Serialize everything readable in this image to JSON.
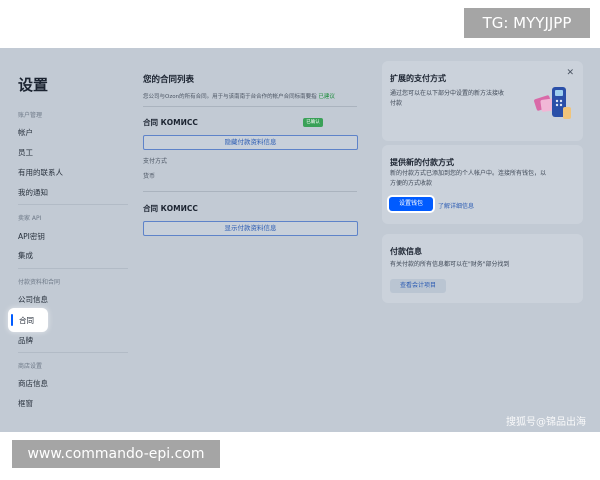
{
  "overlay": {
    "tg_label": "TG: MYYJJPP",
    "url_label": "www.commando-epi.com"
  },
  "watermark": "搜狐号@锦品出海",
  "sidebar": {
    "title": "设置",
    "groups": [
      {
        "label": "账户管理",
        "items": [
          "帐户",
          "员工",
          "有用的联系人",
          "我的通知"
        ]
      },
      {
        "label": "卖家 API",
        "items": [
          "API密钥",
          "集成"
        ]
      },
      {
        "label": "付款资料和合同",
        "items": [
          "公司信息",
          "合同",
          "品牌"
        ]
      },
      {
        "label": "商店设置",
        "items": [
          "商店信息",
          "框窗"
        ]
      }
    ],
    "active_item": "合同"
  },
  "contracts": {
    "title": "您的合同列表",
    "description": "您公司与Ozon的所有合同。用于与该南南于台合作的帐户合同标南要指",
    "description_link": "已建议",
    "items": [
      {
        "name": "合同 КОМИСС",
        "badge": "已确认",
        "toggle_label": "隐藏付款资料信息",
        "fields": [
          {
            "label": "支付方式"
          },
          {
            "label": "货币"
          }
        ]
      },
      {
        "name": "合同 КОМИСС",
        "toggle_label": "显示付款资料信息"
      }
    ]
  },
  "cards": {
    "extended_payment": {
      "title": "扩展的支付方式",
      "text_line1": "通过您可以在以下部分中设置的新方法接收",
      "text_line2": "付款"
    },
    "new_payment": {
      "title": "提供新的付款方式",
      "text_line1": "新的付款方式已添加到您的个人帐户中。连接所有钱包，以",
      "text_line2": "方便的方式收款",
      "primary_button": "设置钱包",
      "link_button": "了解详细信息"
    },
    "payment_info": {
      "title": "付款信息",
      "text": "有关付款的所有信息都可以在\"财务\"部分找到",
      "button": "查看会计项目"
    }
  },
  "icons": [
    "close-icon",
    "payment-terminal-illustration"
  ],
  "colors": {
    "accent": "#005bff",
    "success": "#3aa158"
  }
}
